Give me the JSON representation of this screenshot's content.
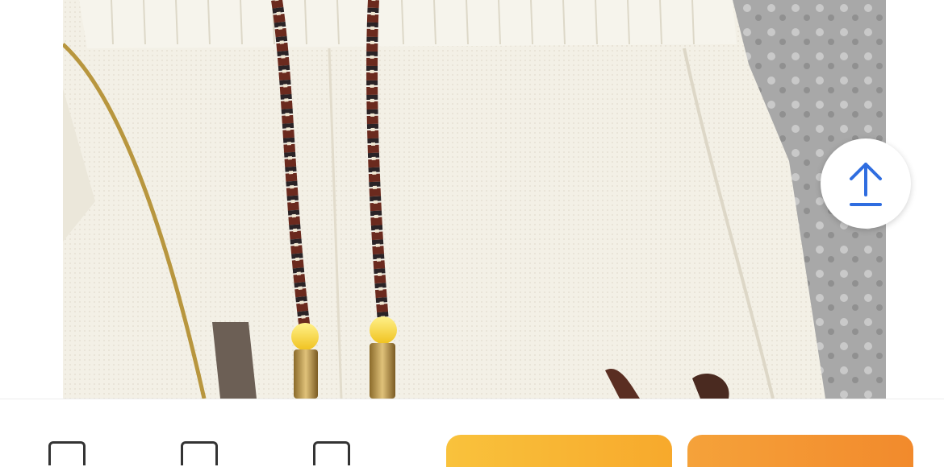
{
  "product": {
    "image_alt": "",
    "colors": {
      "fabric": "#f3f0e6",
      "wall": "#a9a9a9",
      "cord_dark": "#2a2326",
      "cord_brown": "#6b2a1e",
      "bead": "#f5d132",
      "accent_blue": "#2f6de0"
    }
  },
  "floating": {
    "icon": "upload-arrow-icon"
  },
  "bottom_bar": {
    "nav_icons": [
      "shop-icon",
      "service-icon",
      "cart-icon"
    ],
    "add_to_cart_label": "",
    "buy_now_label": ""
  }
}
